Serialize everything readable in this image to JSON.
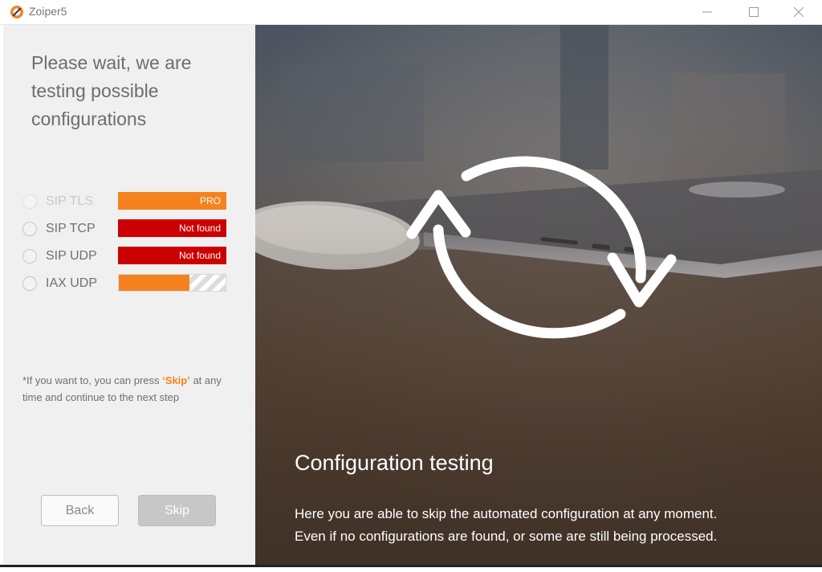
{
  "window": {
    "title": "Zoiper5",
    "controls": {
      "minimize_icon": "minimize-icon",
      "maximize_icon": "maximize-icon",
      "close_icon": "close-icon"
    }
  },
  "left_panel": {
    "heading": "Please wait, we are testing possible configurations",
    "protocols": [
      {
        "label": "SIP TLS",
        "status": "PRO",
        "bar_color": "#f5821f",
        "dimmed": true
      },
      {
        "label": "SIP TCP",
        "status": "Not found",
        "bar_color": "#cc0000",
        "dimmed": false
      },
      {
        "label": "SIP UDP",
        "status": "Not found",
        "bar_color": "#cc0000",
        "dimmed": false
      },
      {
        "label": "IAX UDP",
        "status": "",
        "progress": 0.66,
        "bar_color": "#f5821f",
        "dimmed": false
      }
    ],
    "note_prefix": "*If you want to, you can press ",
    "note_highlight": "‘Skip’",
    "note_suffix": " at any time and continue to the next step",
    "back_button": "Back",
    "skip_button": "Skip"
  },
  "right_panel": {
    "title": "Configuration testing",
    "description": "Here you are able to skip the automated configuration at any moment. Even if no configurations are found, or some are still being processed.",
    "icon": "refresh-icon"
  },
  "colors": {
    "accent": "#f5821f",
    "error": "#cc0000",
    "panel_bg": "#f0f0f0"
  }
}
